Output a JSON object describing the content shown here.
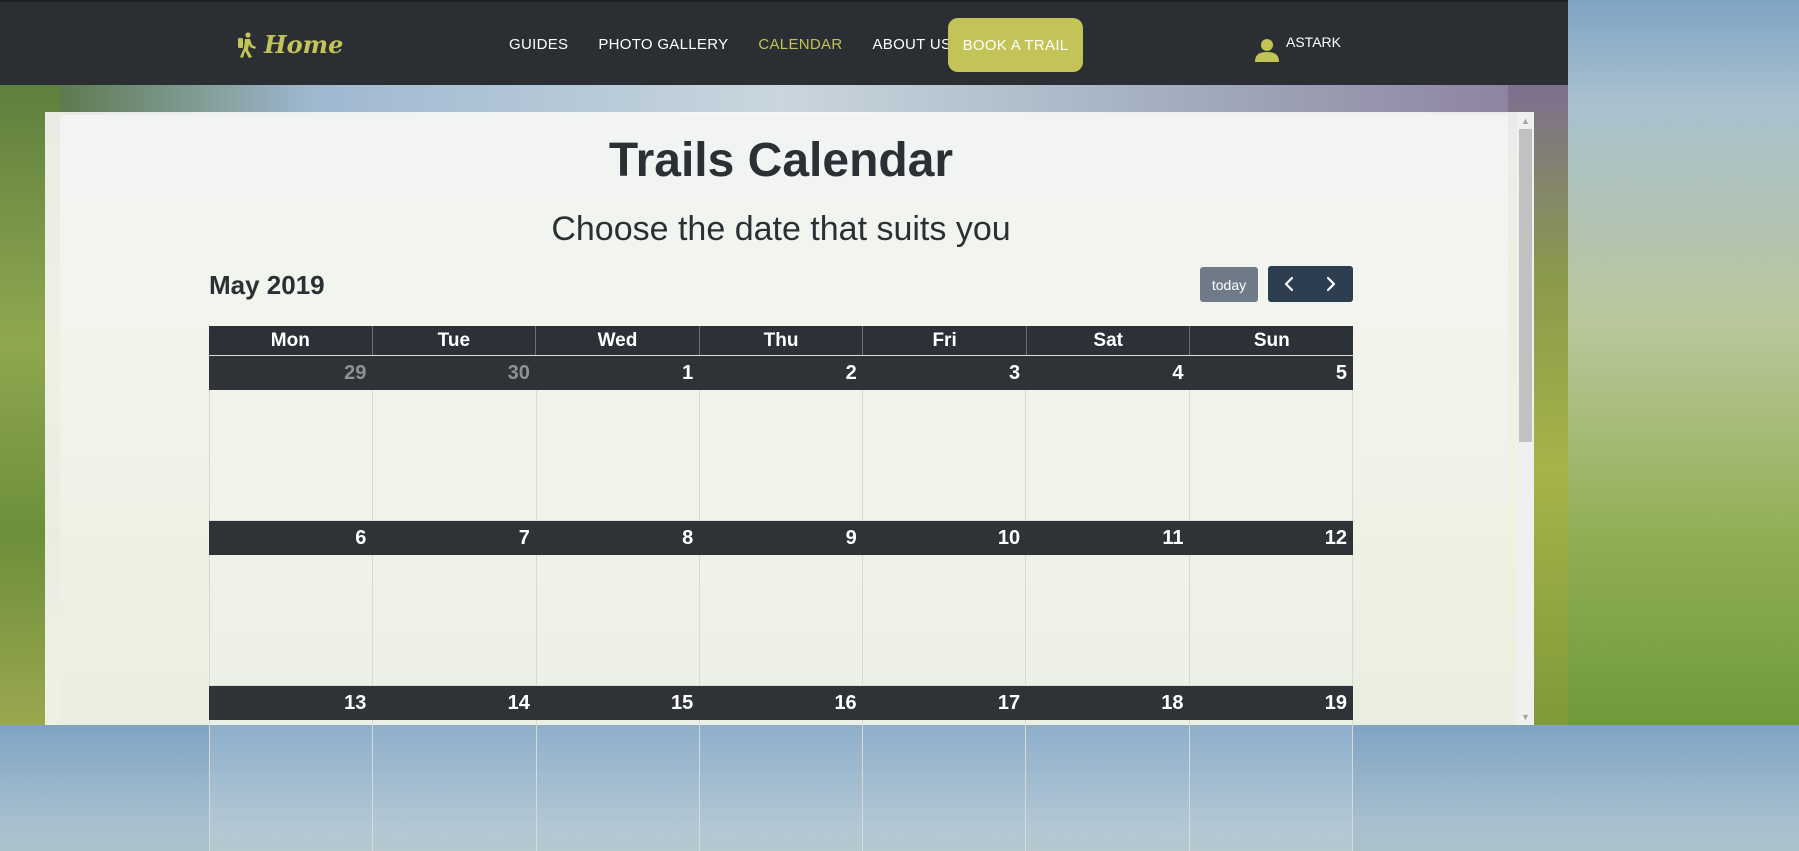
{
  "nav": {
    "brand": "Home",
    "links": [
      "GUIDES",
      "PHOTO GALLERY",
      "CALENDAR",
      "ABOUT US"
    ],
    "active": "CALENDAR",
    "cta": "BOOK A TRAIL",
    "user": "ASTARK"
  },
  "page": {
    "title": "Trails Calendar",
    "subtitle": "Choose the date that suits you"
  },
  "calendar": {
    "month_label": "May 2019",
    "today_label": "today",
    "weekdays": [
      "Mon",
      "Tue",
      "Wed",
      "Thu",
      "Fri",
      "Sat",
      "Sun"
    ],
    "weeks": [
      [
        "29",
        "30",
        "1",
        "2",
        "3",
        "4",
        "5"
      ],
      [
        "6",
        "7",
        "8",
        "9",
        "10",
        "11",
        "12"
      ],
      [
        "13",
        "14",
        "15",
        "16",
        "17",
        "18",
        "19"
      ]
    ],
    "other_month_days": [
      "29",
      "30"
    ]
  },
  "colors": {
    "navbar": "#2b2f33",
    "accent": "#c3c457",
    "calendar_header": "#2c3137",
    "nav_button": "#2c3e50",
    "today_button": "#6f7b88"
  },
  "icons": {
    "brand": "hiker-icon",
    "user": "user-icon",
    "prev": "chevron-left-icon",
    "next": "chevron-right-icon"
  }
}
